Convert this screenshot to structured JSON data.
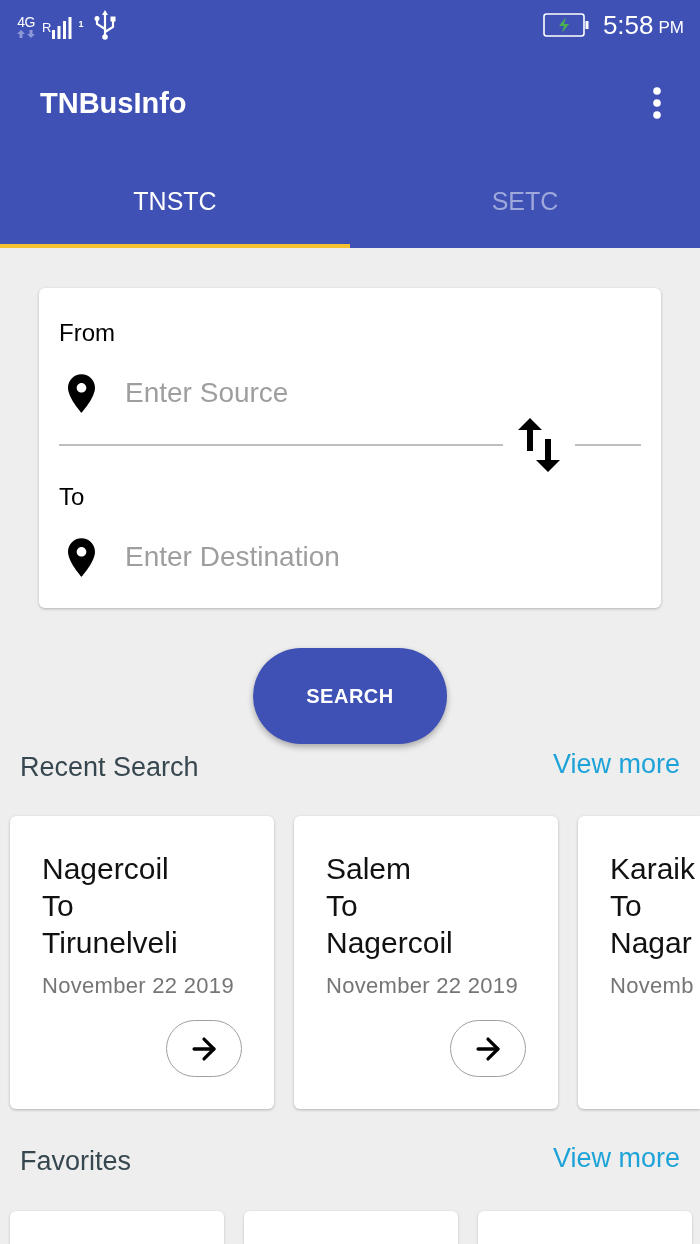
{
  "status_bar": {
    "network": "4G",
    "roaming": "R",
    "sim": "1",
    "time": "5:58",
    "meridiem": "PM"
  },
  "app_bar": {
    "title": "TNBusInfo"
  },
  "tabs": [
    {
      "label": "TNSTC",
      "selected": true
    },
    {
      "label": "SETC",
      "selected": false
    }
  ],
  "search_form": {
    "from_label": "From",
    "source_placeholder": "Enter Source",
    "to_label": "To",
    "destination_placeholder": "Enter Destination",
    "button": "SEARCH"
  },
  "recent_search": {
    "title": "Recent Search",
    "view_more": "View more",
    "items": [
      {
        "from": "Nagercoil",
        "connector": "To",
        "to": "Tirunelveli",
        "date": "November 22 2019",
        "cut_off": false
      },
      {
        "from": "Salem",
        "connector": "To",
        "to": "Nagercoil",
        "date": "November 22 2019",
        "cut_off": false
      },
      {
        "from": "Karaik",
        "connector": "To",
        "to": "Nagar",
        "date": "Novemb",
        "cut_off": true
      }
    ]
  },
  "favorites": {
    "title": "Favorites",
    "view_more": "View more",
    "cards": [
      {
        "kind": "blank"
      },
      {
        "kind": "blank"
      },
      {
        "kind": "blank"
      }
    ]
  }
}
